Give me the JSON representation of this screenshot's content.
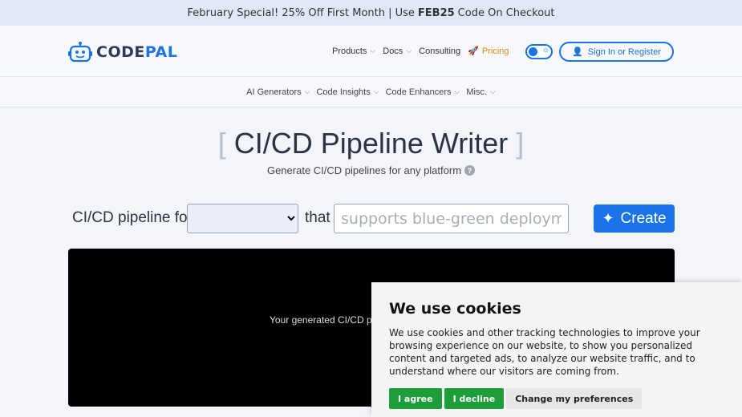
{
  "promo": {
    "prefix": "February Special! 25% Off First Month | Use",
    "code": "FEB25",
    "suffix": "Code On Checkout"
  },
  "header": {
    "logo": {
      "part1": "CODE",
      "part2": "PAL"
    },
    "nav": [
      {
        "label": "Products",
        "dropdown": true
      },
      {
        "label": "Docs",
        "dropdown": true
      },
      {
        "label": "Consulting",
        "dropdown": false
      },
      {
        "label": "Pricing",
        "dropdown": false
      }
    ],
    "signin_label": "Sign In or Register"
  },
  "subnav": [
    {
      "label": "AI Generators"
    },
    {
      "label": "Code Insights"
    },
    {
      "label": "Code Enhancers"
    },
    {
      "label": "Misc."
    }
  ],
  "main": {
    "title": "CI/CD Pipeline Writer",
    "subtitle": "Generate CI/CD pipelines for any platform",
    "form_label": "CI/CD pipeline for",
    "platform_selected": "",
    "that_label": "that",
    "feature_placeholder": "supports blue-green deployments",
    "feature_value": "",
    "create_label": "Create",
    "output_placeholder": "Your generated CI/CD pip"
  },
  "cookie": {
    "title": "We use cookies",
    "text": "We use cookies and other tracking technologies to improve your browsing experience on our website, to show you personalized content and targeted ads, to analyze our website traffic, and to understand where our visitors are coming from.",
    "agree": "I agree",
    "decline": "I decline",
    "preferences": "Change my preferences"
  },
  "colors": {
    "accent": "#1a73e8",
    "pricing": "#e58a1f",
    "cookie_green": "#1e9e3a"
  }
}
